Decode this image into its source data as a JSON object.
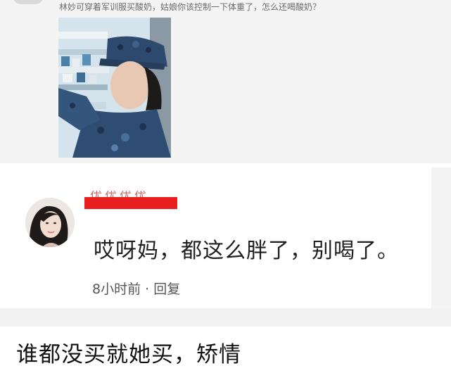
{
  "post": {
    "caption": "林妙可穿着军训服买酸奶，姑娘你该控制一下体重了，怎么还喝酸奶？"
  },
  "comment": {
    "username": "优优优优",
    "text": "哎呀妈，都这么胖了，别喝了。",
    "time": "8小时前",
    "separator": "·",
    "reply_label": "回复",
    "redaction_color": "#e81d1d"
  },
  "footer": {
    "text": "谁都没买就她买，矫情"
  }
}
